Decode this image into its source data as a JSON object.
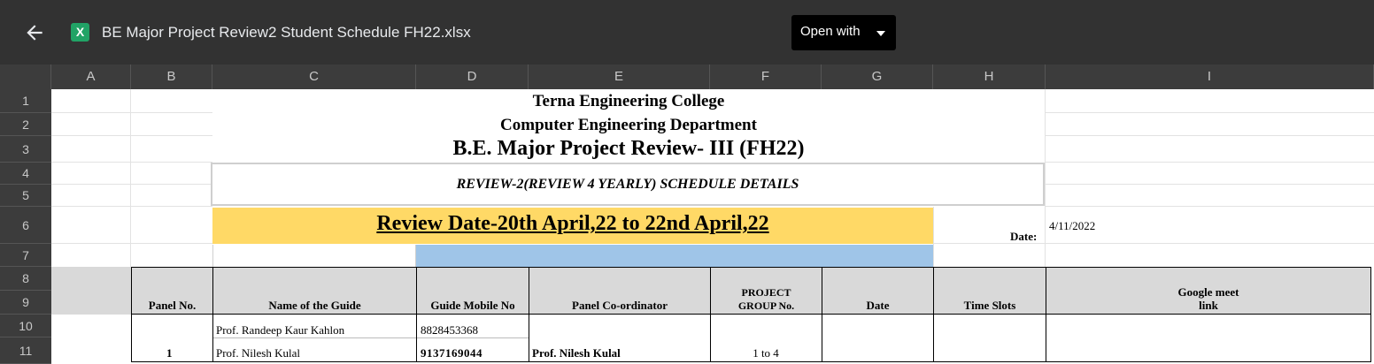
{
  "topbar": {
    "file_icon_letter": "X",
    "file_name": "BE Major Project Review2 Student Schedule FH22.xlsx",
    "open_with_label": "Open with"
  },
  "columns": [
    "A",
    "B",
    "C",
    "D",
    "E",
    "F",
    "G",
    "H",
    "I"
  ],
  "rows": [
    "1",
    "2",
    "3",
    "4",
    "5",
    "6",
    "7",
    "8",
    "9",
    "10",
    "11"
  ],
  "sheet": {
    "college": "Terna Engineering College",
    "department": "Computer Engineering Department",
    "review_title": "B.E. Major Project Review- III (FH22)",
    "schedule_title": "REVIEW-2(REVIEW 4 YEARLY) SCHEDULE DETAILS",
    "review_date": "Review Date-20th April,22 to 22nd April,22",
    "date_label": "Date:",
    "date_value": "4/11/2022",
    "headers": {
      "panel_no": "Panel No.",
      "guide_name": "Name of the Guide",
      "guide_mobile": "Guide Mobile No",
      "panel_coordinator": "Panel Co-ordinator",
      "project_group_line1": "PROJECT",
      "project_group_line2": "GROUP No.",
      "date": "Date",
      "time_slots": "Time Slots",
      "meet_line1": "Google meet",
      "meet_line2": "link"
    },
    "rows": [
      {
        "guide": "Prof. Randeep Kaur Kahlon",
        "mobile": "8828453368"
      },
      {
        "panel": "1",
        "guide": "Prof. Nilesh Kulal",
        "mobile": "9137169044",
        "coordinator": "Prof. Nilesh Kulal",
        "group": "1 to 4"
      }
    ]
  }
}
